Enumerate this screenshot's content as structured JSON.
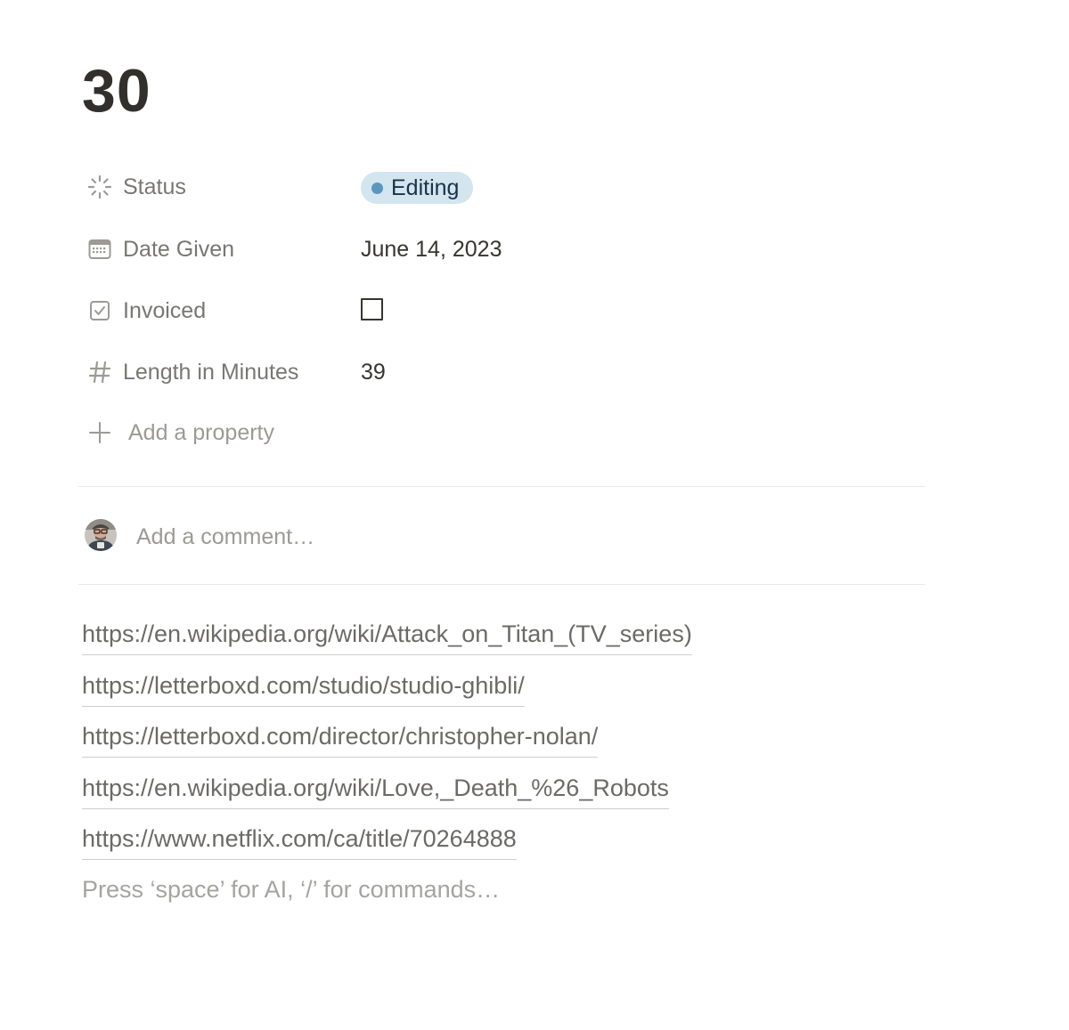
{
  "page": {
    "title": "30"
  },
  "properties": [
    {
      "label": "Status",
      "icon": "status-icon"
    },
    {
      "label": "Date Given",
      "icon": "calendar-icon"
    },
    {
      "label": "Invoiced",
      "icon": "checkbox-icon"
    },
    {
      "label": "Length in Minutes",
      "icon": "hash-icon"
    }
  ],
  "values": {
    "status": "Editing",
    "status_color": "#5b97bd",
    "status_bg": "#d3e5ef",
    "date_given": "June 14, 2023",
    "invoiced": false,
    "length_in_minutes": "39"
  },
  "add_property": {
    "label": "Add a property",
    "icon": "plus-icon"
  },
  "comment": {
    "placeholder": "Add a comment…",
    "avatar_icon": "user-avatar"
  },
  "links": [
    "https://en.wikipedia.org/wiki/Attack_on_Titan_(TV_series)",
    "https://letterboxd.com/studio/studio-ghibli/",
    "https://letterboxd.com/director/christopher-nolan/",
    "https://en.wikipedia.org/wiki/Love,_Death_%26_Robots",
    "https://www.netflix.com/ca/title/70264888"
  ],
  "editor": {
    "placeholder": "Press ‘space’ for AI, ‘/’ for commands…"
  }
}
